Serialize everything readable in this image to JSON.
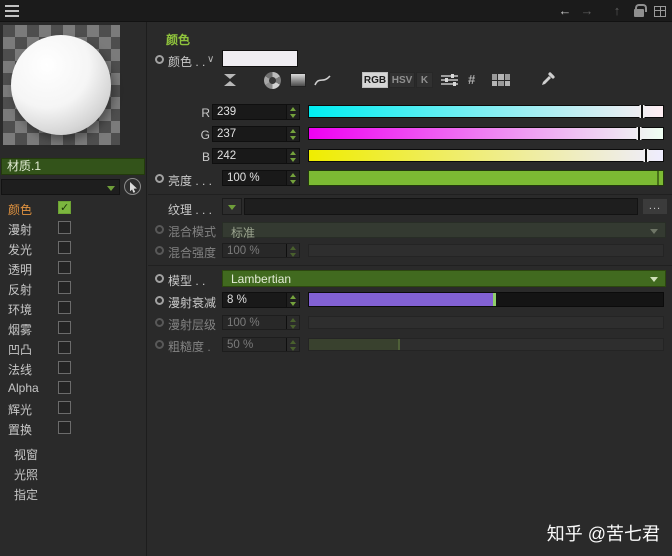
{
  "topbar": {
    "icons": {
      "back": "←",
      "forward": "→",
      "up": "↑"
    }
  },
  "left_panel": {
    "material_name": "材质.1",
    "channels": [
      {
        "label": "颜色",
        "checked": true,
        "active": true
      },
      {
        "label": "漫射",
        "checked": false
      },
      {
        "label": "发光",
        "checked": false
      },
      {
        "label": "透明",
        "checked": false
      },
      {
        "label": "反射",
        "checked": false
      },
      {
        "label": "环境",
        "checked": false
      },
      {
        "label": "烟雾",
        "checked": false
      },
      {
        "label": "凹凸",
        "checked": false
      },
      {
        "label": "法线",
        "checked": false
      },
      {
        "label": "Alpha",
        "checked": false
      },
      {
        "label": "辉光",
        "checked": false
      },
      {
        "label": "置换",
        "checked": false
      }
    ],
    "sections": [
      "视窗",
      "光照",
      "指定"
    ]
  },
  "panel": {
    "header": "颜色",
    "color_row": {
      "label": "颜色 . .",
      "chevron": "∨"
    },
    "toolbar": {
      "rgb": "RGB",
      "hsv": "HSV",
      "k": "K",
      "hex": "#"
    },
    "r": {
      "label": "R",
      "value": "239"
    },
    "g": {
      "label": "G",
      "value": "237"
    },
    "b": {
      "label": "B",
      "value": "242"
    },
    "brightness": {
      "label": "亮度 . . .",
      "value": "100 %"
    },
    "texture": {
      "label": "纹理 . . .",
      "browse": "..."
    },
    "mix_mode": {
      "label": "混合模式",
      "value": "标准"
    },
    "mix_strength": {
      "label": "混合强度",
      "value": "100 %"
    },
    "model": {
      "label": "模型 . .",
      "value": "Lambertian"
    },
    "diffuse_falloff": {
      "label": "漫射衰减",
      "value": "8 %"
    },
    "diffuse_level": {
      "label": "漫射层级",
      "value": "100 %"
    },
    "roughness": {
      "label": "粗糙度 .",
      "value": "50 %"
    }
  },
  "colors": {
    "accent_green": "#7cba33",
    "swatch_color": "#efedf2",
    "slider_purple": "#8261d3",
    "active_channel_orange": "#e0923f",
    "material_field_green": "#33531a",
    "model_dropdown_green": "#416a1f"
  },
  "watermark": "知乎 @苦七君"
}
